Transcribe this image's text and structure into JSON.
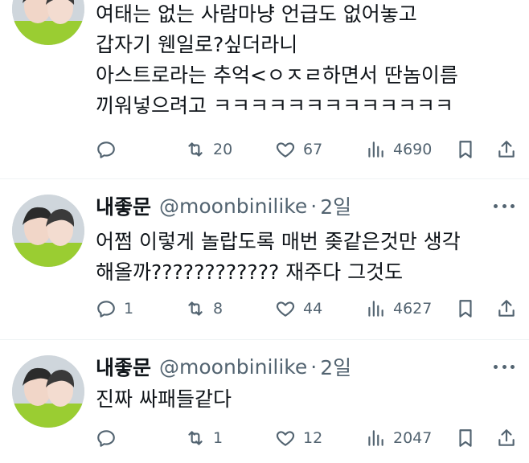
{
  "tweets": [
    {
      "display_name": "",
      "handle": "",
      "time": "",
      "lines": [
        "여태는 없는 사람마냥 언급도 없어놓고",
        "갑자기 웬일로?싶더라니",
        "아스트로라는 추억<ㅇㅈㄹ하면서 딴놈이름",
        "끼워넣으려고 ㅋㅋㅋㅋㅋㅋㅋㅋㅋㅋㅋㅋㅋ"
      ],
      "replies": "",
      "retweets": "20",
      "likes": "67",
      "views": "4690"
    },
    {
      "display_name": "내좋문",
      "handle": "@moonbinilike",
      "time": "2일",
      "lines": [
        "어쩜 이렇게 놀랍도록 매번 좆같은것만 생각",
        "해올까???????????? 재주다 그것도"
      ],
      "replies": "1",
      "retweets": "8",
      "likes": "44",
      "views": "4627"
    },
    {
      "display_name": "내좋문",
      "handle": "@moonbinilike",
      "time": "2일",
      "lines": [
        "진짜 싸패들같다"
      ],
      "replies": "",
      "retweets": "1",
      "likes": "12",
      "views": "2047"
    }
  ],
  "separator": "·",
  "icons": {
    "reply": "reply-icon",
    "retweet": "retweet-icon",
    "like": "heart-icon",
    "views": "views-icon",
    "bookmark": "bookmark-icon",
    "share": "share-icon",
    "more": "more-icon"
  },
  "colors": {
    "text": "#0f1419",
    "secondary": "#536471",
    "divider": "#eff3f4"
  }
}
